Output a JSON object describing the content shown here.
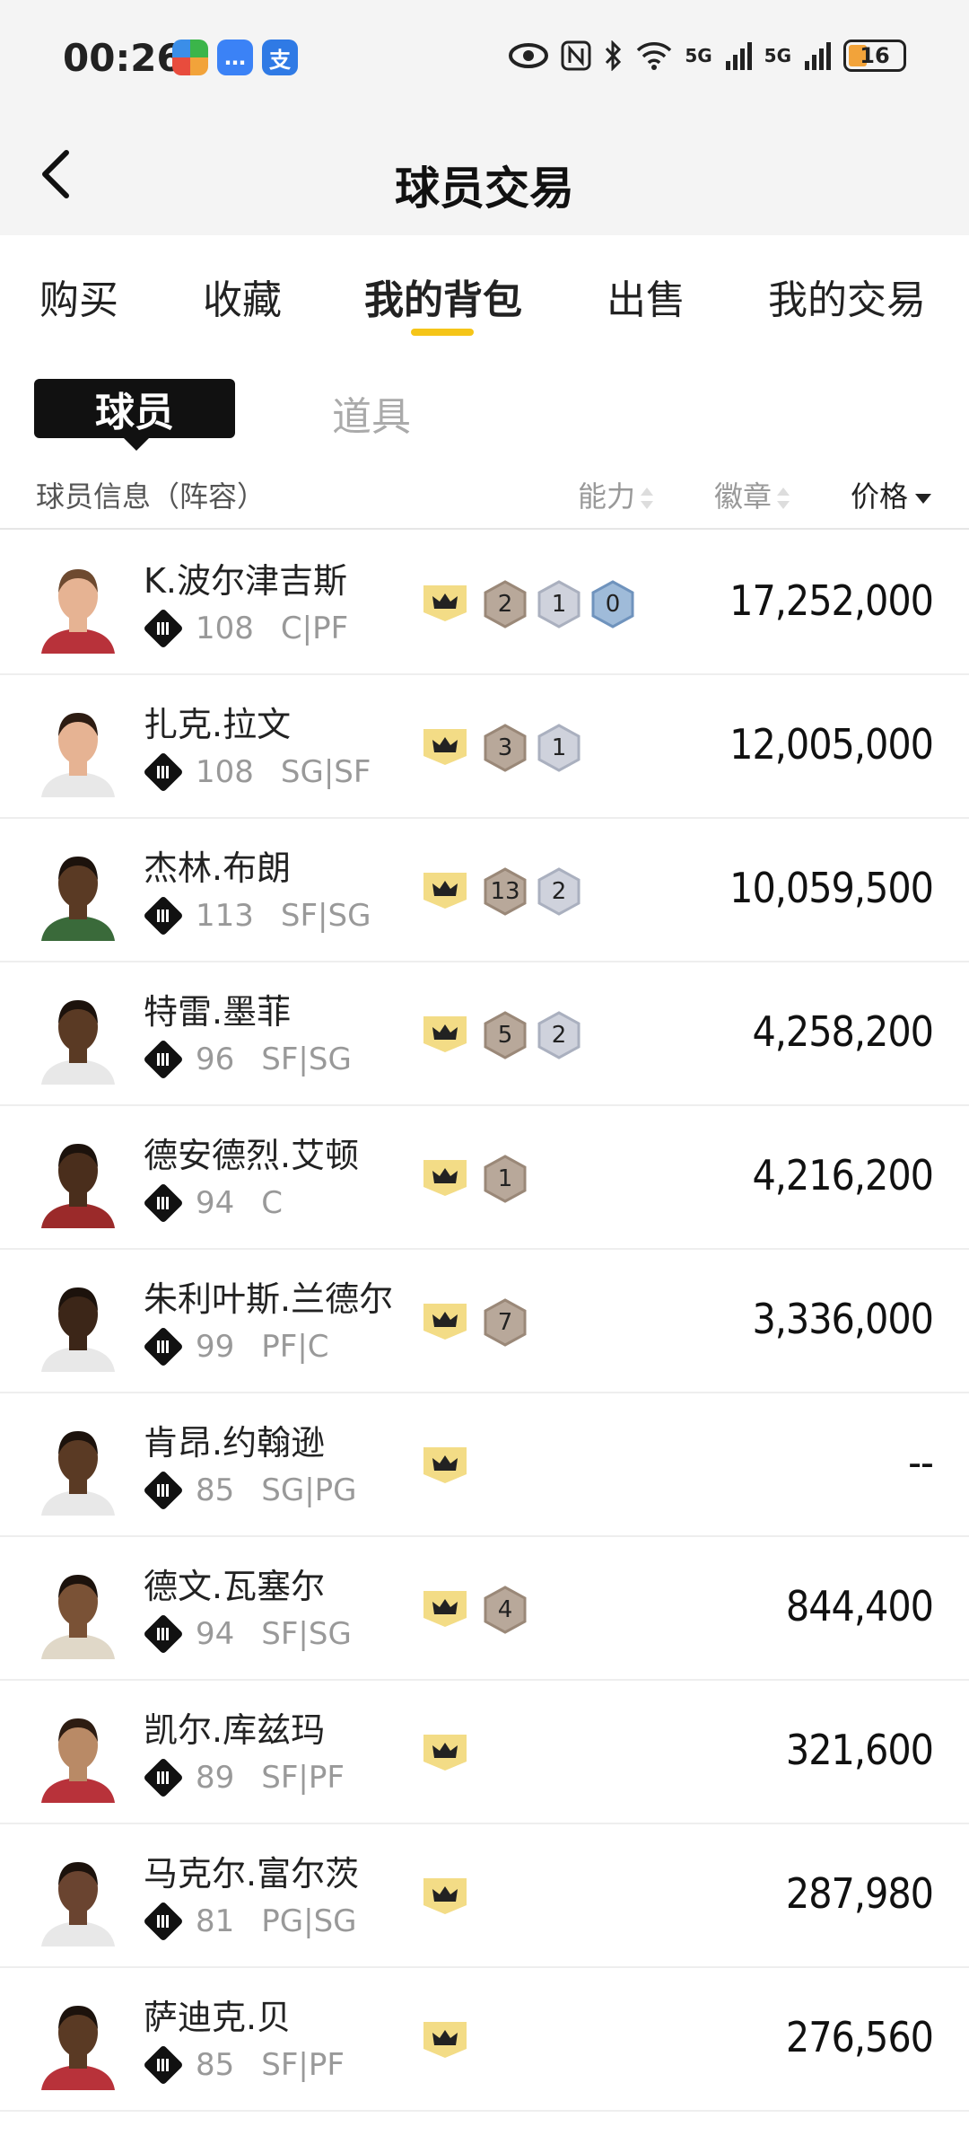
{
  "status_bar": {
    "time": "00:26",
    "signal_1": "5G",
    "signal_2": "5G",
    "battery": "16"
  },
  "header": {
    "title": "球员交易"
  },
  "tabs": [
    "购买",
    "收藏",
    "我的背包",
    "出售",
    "我的交易"
  ],
  "active_tab": 2,
  "subtabs": {
    "active": "球员",
    "inactive": "道具"
  },
  "columns": {
    "info": "球员信息（阵容）",
    "ability": "能力",
    "badge": "徽章",
    "price": "价格"
  },
  "colors": {
    "accent": "#f5c518",
    "crown_bg": "#f3dc86",
    "bronze": "#b8a89a",
    "silver": "#cfd2dc",
    "blue": "#9fbbd9"
  },
  "players": [
    {
      "name": "K.波尔津吉斯",
      "rating": "108",
      "pos": "C|PF",
      "badges": [
        {
          "tier": "bronze",
          "n": "2"
        },
        {
          "tier": "silver",
          "n": "1"
        },
        {
          "tier": "blue",
          "n": "0"
        }
      ],
      "price": "17,252,000",
      "jersey": "#b8323a",
      "skin": "#e6b393",
      "hair": "#6e4a30"
    },
    {
      "name": "扎克.拉文",
      "rating": "108",
      "pos": "SG|SF",
      "badges": [
        {
          "tier": "bronze",
          "n": "3"
        },
        {
          "tier": "silver",
          "n": "1"
        }
      ],
      "price": "12,005,000",
      "jersey": "#e8e8e8",
      "skin": "#e6b393",
      "hair": "#2d1c12"
    },
    {
      "name": "杰林.布朗",
      "rating": "113",
      "pos": "SF|SG",
      "badges": [
        {
          "tier": "bronze",
          "n": "13"
        },
        {
          "tier": "silver",
          "n": "2"
        }
      ],
      "price": "10,059,500",
      "jersey": "#3a6a3a",
      "skin": "#5a3a24",
      "hair": "#1c120c"
    },
    {
      "name": "特雷.墨菲",
      "rating": "96",
      "pos": "SF|SG",
      "badges": [
        {
          "tier": "bronze",
          "n": "5"
        },
        {
          "tier": "silver",
          "n": "2"
        }
      ],
      "price": "4,258,200",
      "jersey": "#e8e8e8",
      "skin": "#5a3a24",
      "hair": "#1c120c"
    },
    {
      "name": "德安德烈.艾顿",
      "rating": "94",
      "pos": "C",
      "badges": [
        {
          "tier": "bronze",
          "n": "1"
        }
      ],
      "price": "4,216,200",
      "jersey": "#9b2a2a",
      "skin": "#4a2e1c",
      "hair": "#1c120c"
    },
    {
      "name": "朱利叶斯.兰德尔",
      "rating": "99",
      "pos": "PF|C",
      "badges": [
        {
          "tier": "bronze",
          "n": "7"
        }
      ],
      "price": "3,336,000",
      "jersey": "#e8e8e8",
      "skin": "#3c2618",
      "hair": "#1c120c"
    },
    {
      "name": "肯昂.约翰逊",
      "rating": "85",
      "pos": "SG|PG",
      "badges": [],
      "price": "--",
      "jersey": "#e8e8e8",
      "skin": "#5a3a24",
      "hair": "#1c120c"
    },
    {
      "name": "德文.瓦塞尔",
      "rating": "94",
      "pos": "SF|SG",
      "badges": [
        {
          "tier": "bronze",
          "n": "4"
        }
      ],
      "price": "844,400",
      "jersey": "#e0d8c8",
      "skin": "#7a5236",
      "hair": "#1c120c"
    },
    {
      "name": "凯尔.库兹玛",
      "rating": "89",
      "pos": "SF|PF",
      "badges": [],
      "price": "321,600",
      "jersey": "#b8323a",
      "skin": "#b98a66",
      "hair": "#2d1c12"
    },
    {
      "name": "马克尔.富尔茨",
      "rating": "81",
      "pos": "PG|SG",
      "badges": [],
      "price": "287,980",
      "jersey": "#e8e8e8",
      "skin": "#6a4430",
      "hair": "#1c120c"
    },
    {
      "name": "萨迪克.贝",
      "rating": "85",
      "pos": "SF|PF",
      "badges": [],
      "price": "276,560",
      "jersey": "#b8323a",
      "skin": "#5a3a24",
      "hair": "#1c120c"
    }
  ]
}
